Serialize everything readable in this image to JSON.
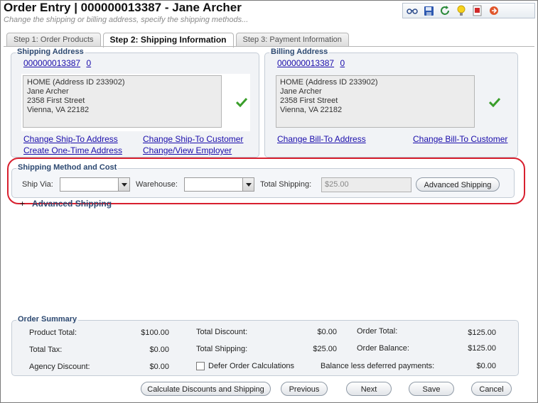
{
  "header": {
    "title": "Order Entry | 000000013387 - Jane Archer",
    "subtitle": "Change the shipping or billing address, specify the shipping methods..."
  },
  "toolbar": {
    "icons": [
      "glasses-icon",
      "save-icon",
      "refresh-icon",
      "lightbulb-icon",
      "report-icon",
      "exit-icon"
    ]
  },
  "tabs": [
    {
      "label": "Step 1: Order Products",
      "active": false
    },
    {
      "label": "Step 2: Shipping Information",
      "active": true
    },
    {
      "label": "Step 3: Payment Information",
      "active": false
    }
  ],
  "shipping_address": {
    "legend": "Shipping Address",
    "customer_id": "000000013387",
    "customer_suffix": "0",
    "lines": [
      "HOME (Address ID 233902)",
      "Jane Archer",
      "2358 First Street",
      "Vienna, VA 22182"
    ],
    "links": {
      "change_ship_to": "Change Ship-To Address",
      "change_ship_customer": "Change Ship-To Customer",
      "one_time": "Create One-Time Address",
      "employer": "Change/View Employer"
    }
  },
  "billing_address": {
    "legend": "Billing Address",
    "customer_id": "000000013387",
    "customer_suffix": "0",
    "lines": [
      "HOME (Address ID 233902)",
      "Jane Archer",
      "2358 First Street",
      "Vienna, VA 22182"
    ],
    "links": {
      "change_bill_to": "Change Bill-To Address",
      "change_bill_customer": "Change Bill-To Customer"
    }
  },
  "shipping_method": {
    "legend": "Shipping Method and Cost",
    "ship_via_label": "Ship Via:",
    "ship_via_value": "",
    "warehouse_label": "Warehouse:",
    "warehouse_value": "",
    "total_label": "Total Shipping:",
    "total_value": "$25.00",
    "advanced_button": "Advanced Shipping"
  },
  "advanced_toggle": {
    "symbol": "+",
    "label": "Advanced Shipping"
  },
  "summary": {
    "legend": "Order Summary",
    "product_total_label": "Product Total:",
    "product_total": "$100.00",
    "total_tax_label": "Total Tax:",
    "total_tax": "$0.00",
    "agency_discount_label": "Agency Discount:",
    "agency_discount": "$0.00",
    "total_discount_label": "Total Discount:",
    "total_discount": "$0.00",
    "total_shipping_label": "Total Shipping:",
    "total_shipping": "$25.00",
    "defer_label": "Defer Order Calculations",
    "order_total_label": "Order Total:",
    "order_total": "$125.00",
    "order_balance_label": "Order Balance:",
    "order_balance": "$125.00",
    "balance_deferred_label": "Balance less deferred payments:",
    "balance_deferred": "$0.00"
  },
  "footer": {
    "calculate": "Calculate Discounts and Shipping",
    "previous": "Previous",
    "next": "Next",
    "save": "Save",
    "cancel": "Cancel"
  },
  "colors": {
    "legend": "#2e4a72",
    "link": "#1a0dab",
    "highlight_ring": "#d8202f",
    "check": "#3a9e2a"
  }
}
